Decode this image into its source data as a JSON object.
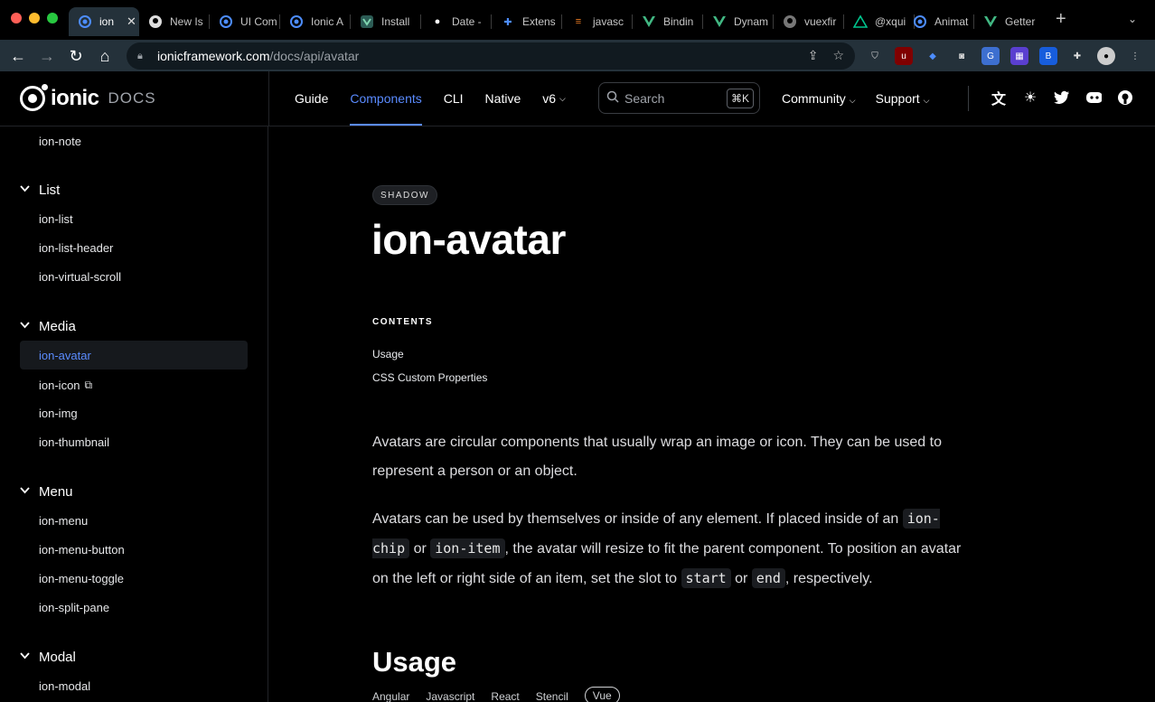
{
  "browser": {
    "tabs": [
      {
        "label": "ion",
        "icon": "ionic-icon",
        "active": true
      },
      {
        "label": "New Is",
        "icon": "github-icon"
      },
      {
        "label": "UI Com",
        "icon": "ionic-icon"
      },
      {
        "label": "Ionic A",
        "icon": "ionic-icon"
      },
      {
        "label": "Install",
        "icon": "vue-icon"
      },
      {
        "label": "Date -",
        "icon": "bird-icon"
      },
      {
        "label": "Extens",
        "icon": "puzzle-icon"
      },
      {
        "label": "javasc",
        "icon": "stackoverflow-icon"
      },
      {
        "label": "Bindin",
        "icon": "vue-icon"
      },
      {
        "label": "Dynam",
        "icon": "vue-icon"
      },
      {
        "label": "vuexfir",
        "icon": "github-icon"
      },
      {
        "label": "@xqui",
        "icon": "nuxt-icon"
      },
      {
        "label": "Animat",
        "icon": "ionic-icon"
      },
      {
        "label": "Getter",
        "icon": "vue-icon"
      }
    ],
    "url_host": "ionicframework.com",
    "url_path": "/docs/api/avatar"
  },
  "header": {
    "logo_word": "ionic",
    "logo_docs": "DOCS",
    "nav": [
      {
        "label": "Guide"
      },
      {
        "label": "Components",
        "active": true
      },
      {
        "label": "CLI"
      },
      {
        "label": "Native"
      },
      {
        "label": "v6",
        "dropdown": true
      }
    ],
    "search_placeholder": "Search",
    "search_shortcut": "⌘K",
    "right_nav": [
      {
        "label": "Community"
      },
      {
        "label": "Support"
      }
    ]
  },
  "sidebar": {
    "top_link": "ion-note",
    "groups": [
      {
        "title": "List",
        "items": [
          "ion-list",
          "ion-list-header",
          "ion-virtual-scroll"
        ]
      },
      {
        "title": "Media",
        "items": [
          "ion-avatar",
          "ion-icon",
          "ion-img",
          "ion-thumbnail"
        ]
      },
      {
        "title": "Menu",
        "items": [
          "ion-menu",
          "ion-menu-button",
          "ion-menu-toggle",
          "ion-split-pane"
        ]
      },
      {
        "title": "Modal",
        "items": [
          "ion-modal"
        ]
      }
    ],
    "active_item": "ion-avatar"
  },
  "main": {
    "badge": "SHADOW",
    "title": "ion-avatar",
    "contents_label": "CONTENTS",
    "toc": [
      "Usage",
      "CSS Custom Properties"
    ],
    "para1": "Avatars are circular components that usually wrap an image or icon. They can be used to represent a person or an object.",
    "para2": {
      "t1": "Avatars can be used by themselves or inside of any element. If placed inside of an ",
      "c1": "ion-chip",
      "t2": " or ",
      "c2": "ion-item",
      "t3": ", the avatar will resize to fit the parent component. To position an avatar on the left or right side of an item, set the slot to ",
      "c3": "start",
      "t4": " or ",
      "c4": "end",
      "t5": ", respectively."
    },
    "usage_heading": "Usage",
    "framework_tabs": [
      "Angular",
      "Javascript",
      "React",
      "Stencil",
      "Vue"
    ]
  },
  "colors": {
    "accent": "#5a8bff",
    "background": "#000000"
  }
}
